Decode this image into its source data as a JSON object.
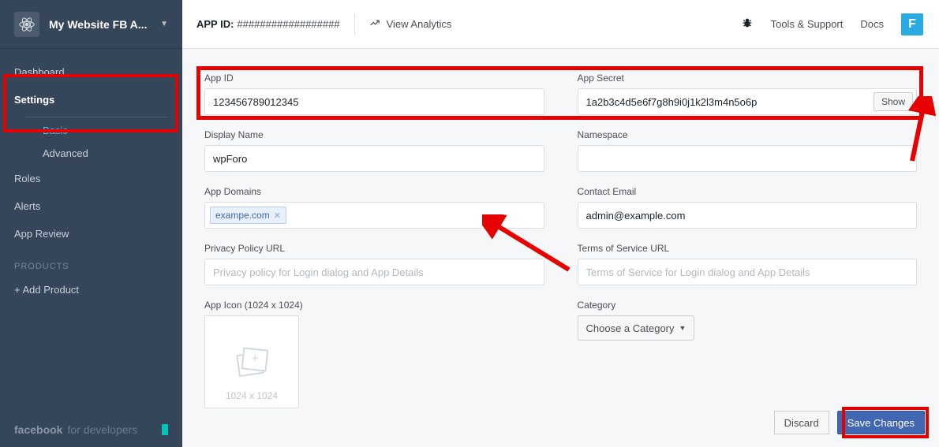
{
  "sidebar": {
    "appName": "My Website FB A...",
    "items": [
      "Dashboard",
      "Settings",
      "Roles",
      "Alerts",
      "App Review"
    ],
    "subItems": [
      "Basic",
      "Advanced"
    ],
    "productsLabel": "PRODUCTS",
    "addProduct": "+ Add Product",
    "footerBrand": "facebook",
    "footerText": "for developers"
  },
  "topbar": {
    "appIdLabel": "APP ID:",
    "appIdVal": "##################",
    "viewAnalytics": "View Analytics",
    "toolsSupport": "Tools & Support",
    "docs": "Docs",
    "userInitial": "F"
  },
  "form": {
    "appId": {
      "label": "App ID",
      "value": "123456789012345"
    },
    "appSecret": {
      "label": "App Secret",
      "value": "1a2b3c4d5e6f7g8h9i0j1k2l3m4n5o6p",
      "showBtn": "Show"
    },
    "displayName": {
      "label": "Display Name",
      "value": "wpForo"
    },
    "namespace": {
      "label": "Namespace",
      "value": ""
    },
    "appDomains": {
      "label": "App Domains",
      "token": "exampe.com"
    },
    "contactEmail": {
      "label": "Contact Email",
      "value": "admin@example.com"
    },
    "privacy": {
      "label": "Privacy Policy URL",
      "placeholder": "Privacy policy for Login dialog and App Details"
    },
    "terms": {
      "label": "Terms of Service URL",
      "placeholder": "Terms of Service for Login dialog and App Details"
    },
    "appIcon": {
      "label": "App Icon (1024 x 1024)",
      "hint": "1024 x 1024"
    },
    "category": {
      "label": "Category",
      "selectLabel": "Choose a Category"
    }
  },
  "actions": {
    "discard": "Discard",
    "save": "Save Changes"
  }
}
